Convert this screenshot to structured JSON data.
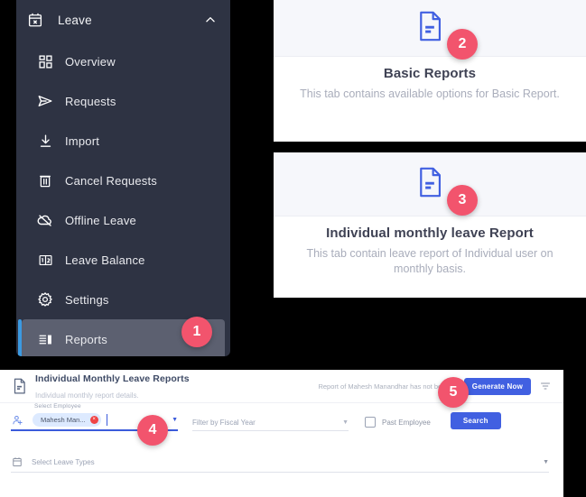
{
  "sidebar": {
    "header": {
      "label": "Leave",
      "icon": "calendar-x-icon",
      "chevron": "chevron-up-icon"
    },
    "items": [
      {
        "label": "Overview",
        "icon": "dashboard-grid-icon"
      },
      {
        "label": "Requests",
        "icon": "send-arrow-icon"
      },
      {
        "label": "Import",
        "icon": "download-import-icon"
      },
      {
        "label": "Cancel Requests",
        "icon": "trash-icon"
      },
      {
        "label": "Offline Leave",
        "icon": "cloud-off-icon"
      },
      {
        "label": "Leave Balance",
        "icon": "balance-number-icon"
      },
      {
        "label": "Settings",
        "icon": "gear-icon"
      },
      {
        "label": "Reports",
        "icon": "report-list-icon",
        "active": true,
        "badge": "1"
      }
    ]
  },
  "cards": [
    {
      "icon": "document-lines-icon",
      "badge": "2",
      "title": "Basic Reports",
      "description": "This tab contains available options for Basic Report."
    },
    {
      "icon": "document-lines-icon",
      "badge": "3",
      "title": "Individual monthly leave Report",
      "description": "This tab contain leave report of Individual user on monthly basis."
    }
  ],
  "bottom_panel": {
    "header": {
      "icon": "document-lines-icon",
      "title": "Individual Monthly Leave Reports",
      "subtitle": "Individual monthly report details.",
      "note": "Report of Mahesh Manandhar has not been g",
      "generate_label": "Generate Now",
      "filter_icon": "filter-funnel-icon",
      "badge": "5"
    },
    "form": {
      "employee": {
        "label": "Select Employee",
        "icon": "person-add-icon",
        "chip": "Mahesh Man...",
        "chip_remove": "×",
        "dropdown_icon": "caret-down-icon",
        "badge": "4"
      },
      "fiscal_year": {
        "placeholder": "Filter by Fiscal Year",
        "dropdown_icon": "caret-down-icon"
      },
      "past_employee": {
        "label": "Past Employee",
        "checked": false
      },
      "search_label": "Search",
      "leave_types": {
        "label": "Select Leave Types",
        "icon": "calendar-icon",
        "dropdown_icon": "caret-down-icon"
      }
    }
  },
  "colors": {
    "sidebar_bg": "#2e3343",
    "accent_blue": "#4160e1",
    "badge_pink": "#f2546d",
    "active_border": "#3b9ae1"
  }
}
